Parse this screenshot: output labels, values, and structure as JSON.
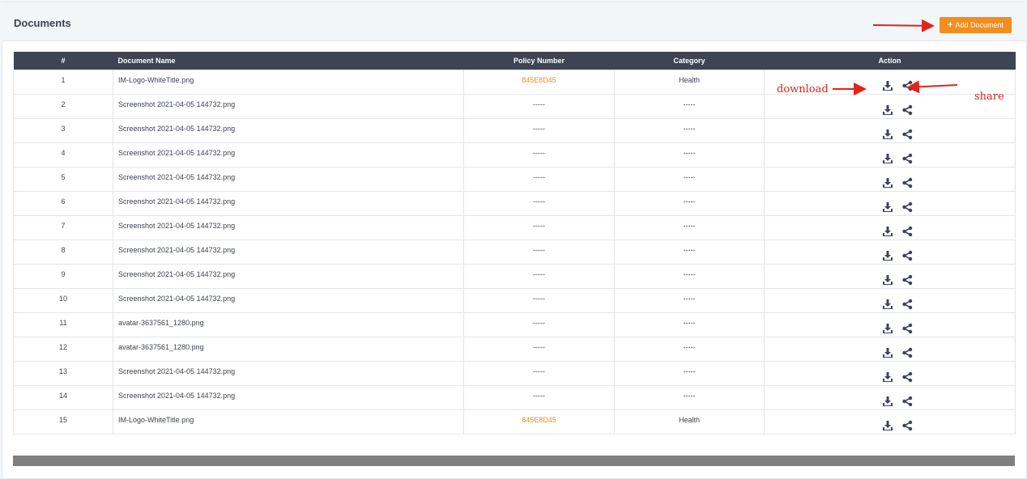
{
  "header": {
    "title": "Documents",
    "add_button_label": "Add Document",
    "add_button_icon": "plus-icon"
  },
  "table": {
    "columns": [
      "#",
      "Document Name",
      "Policy Number",
      "Category",
      "Action"
    ],
    "rows": [
      {
        "num": "1",
        "name": "IM-Logo-WhiteTitle.png",
        "policy": "845E8D45",
        "category": "Health"
      },
      {
        "num": "2",
        "name": "Screenshot 2021-04-05 144732.png",
        "policy": "-----",
        "category": "-----"
      },
      {
        "num": "3",
        "name": "Screenshot 2021-04-05 144732.png",
        "policy": "-----",
        "category": "-----"
      },
      {
        "num": "4",
        "name": "Screenshot 2021-04-05 144732.png",
        "policy": "-----",
        "category": "-----"
      },
      {
        "num": "5",
        "name": "Screenshot 2021-04-05 144732.png",
        "policy": "-----",
        "category": "-----"
      },
      {
        "num": "6",
        "name": "Screenshot 2021-04-05 144732.png",
        "policy": "-----",
        "category": "-----"
      },
      {
        "num": "7",
        "name": "Screenshot 2021-04-05 144732.png",
        "policy": "-----",
        "category": "-----"
      },
      {
        "num": "8",
        "name": "Screenshot 2021-04-05 144732.png",
        "policy": "-----",
        "category": "-----"
      },
      {
        "num": "9",
        "name": "Screenshot 2021-04-05 144732.png",
        "policy": "-----",
        "category": "-----"
      },
      {
        "num": "10",
        "name": "Screenshot 2021-04-05 144732.png",
        "policy": "-----",
        "category": "-----"
      },
      {
        "num": "11",
        "name": "avatar-3637561_1280.png",
        "policy": "-----",
        "category": "-----"
      },
      {
        "num": "12",
        "name": "avatar-3637561_1280.png",
        "policy": "-----",
        "category": "-----"
      },
      {
        "num": "13",
        "name": "Screenshot 2021-04-05 144732.png",
        "policy": "-----",
        "category": "-----"
      },
      {
        "num": "14",
        "name": "Screenshot 2021-04-05 144732.png",
        "policy": "-----",
        "category": "-----"
      },
      {
        "num": "15",
        "name": "IM-Logo-WhiteTitle.png",
        "policy": "845E8D45",
        "category": "Health"
      }
    ],
    "action_icons": [
      "download-icon",
      "share-icon"
    ]
  },
  "annotations": {
    "download_label": "download",
    "share_label": "share"
  },
  "colors": {
    "accent": "#f18e1f",
    "header_bg": "#3e4453",
    "annotation": "#e0241b"
  }
}
